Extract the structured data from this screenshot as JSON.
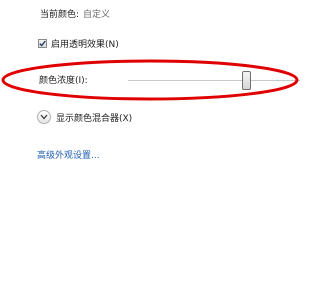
{
  "current_color": {
    "label": "当前颜色:",
    "value": "自定义"
  },
  "transparency": {
    "label": "启用透明效果(N)",
    "checked": true
  },
  "intensity": {
    "label": "颜色浓度(I):",
    "slider_value_percent": 70
  },
  "mixer": {
    "label": "显示颜色混合器(X)",
    "icon": "chevron-down-icon"
  },
  "advanced_link": "高级外观设置...",
  "colors": {
    "link": "#1f5fb0",
    "annotation": "#e00000"
  }
}
